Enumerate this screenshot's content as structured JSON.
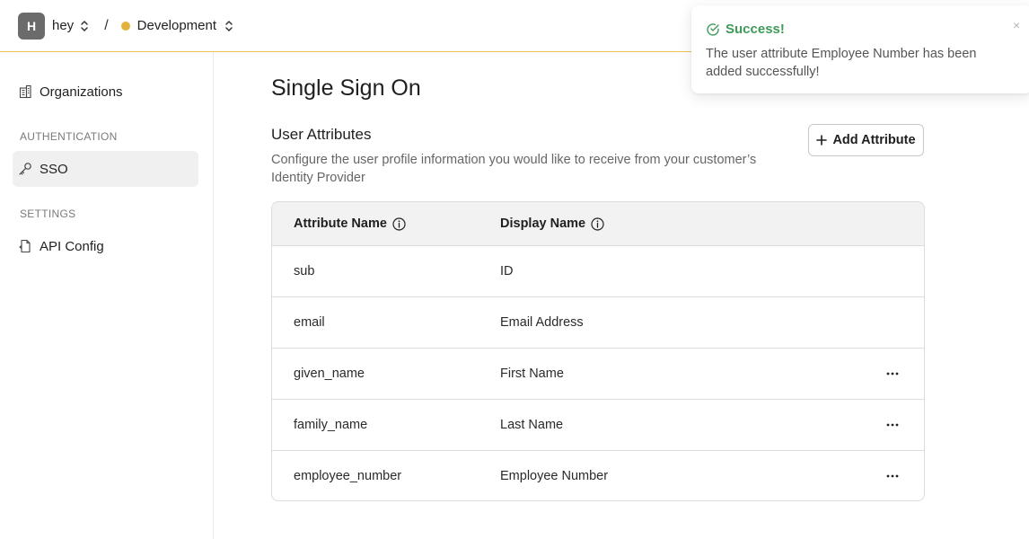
{
  "topbar": {
    "avatar_letter": "H",
    "org_name": "hey",
    "separator": "/",
    "environment": "Development",
    "environment_color": "#e2b23c"
  },
  "sidebar": {
    "items": [
      {
        "label": "Organizations",
        "icon": "building-icon"
      },
      {
        "section": "AUTHENTICATION"
      },
      {
        "label": "SSO",
        "icon": "key-icon",
        "active": true
      },
      {
        "section": "SETTINGS"
      },
      {
        "label": "API Config",
        "icon": "file-code-icon"
      }
    ]
  },
  "main": {
    "title": "Single Sign On",
    "section_title": "User Attributes",
    "section_description": "Configure the user profile information you would like to receive from your customer’s Identity Provider",
    "add_button_label": "Add Attribute",
    "table": {
      "headers": [
        "Attribute Name",
        "Display Name"
      ],
      "rows": [
        {
          "attribute": "sub",
          "display": "ID",
          "has_menu": false
        },
        {
          "attribute": "email",
          "display": "Email Address",
          "has_menu": false
        },
        {
          "attribute": "given_name",
          "display": "First Name",
          "has_menu": true
        },
        {
          "attribute": "family_name",
          "display": "Last Name",
          "has_menu": true
        },
        {
          "attribute": "employee_number",
          "display": "Employee Number",
          "has_menu": true
        }
      ],
      "menu_glyph": "···"
    }
  },
  "toast": {
    "title": "Success!",
    "message": "The user attribute Employee Number has been added successfully!",
    "close_glyph": "×",
    "color": "#3f9a5a"
  }
}
